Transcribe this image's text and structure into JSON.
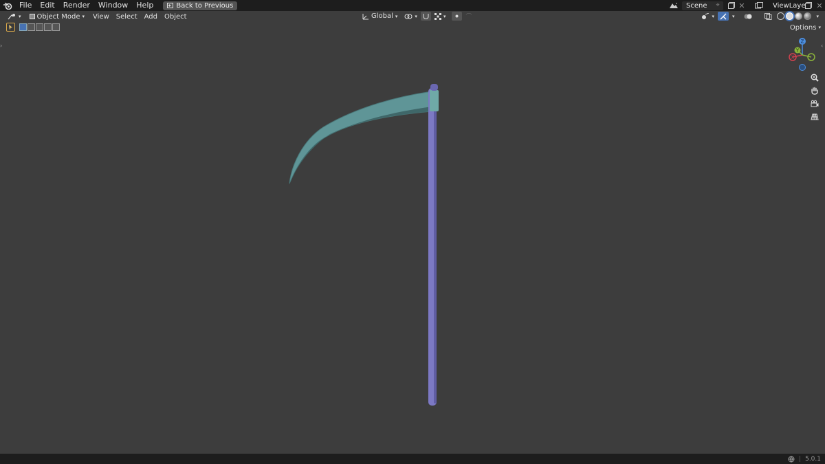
{
  "menu": {
    "file": "File",
    "edit": "Edit",
    "render": "Render",
    "window": "Window",
    "help": "Help",
    "back_to_previous": "Back to Previous"
  },
  "scene": {
    "name": "Scene"
  },
  "view_layer": {
    "name": "ViewLayer"
  },
  "header": {
    "mode": "Object Mode",
    "view": "View",
    "select": "Select",
    "add": "Add",
    "object": "Object",
    "transform_orientation": "Global"
  },
  "options": {
    "label": "Options"
  },
  "gizmo": {
    "z_label": "Z",
    "y_label": "Y",
    "x_label": "X"
  },
  "status": {
    "version": "5.0.1"
  },
  "colors": {
    "blade": "#5f9597",
    "handle": "#7c79c4",
    "background": "#3d3d3d",
    "accent": "#4772b3"
  },
  "icons": {
    "logo": "blender-logo-icon",
    "zoom": "zoom-icon",
    "pan": "hand-icon",
    "camera": "camera-icon",
    "grid": "grid-icon"
  }
}
